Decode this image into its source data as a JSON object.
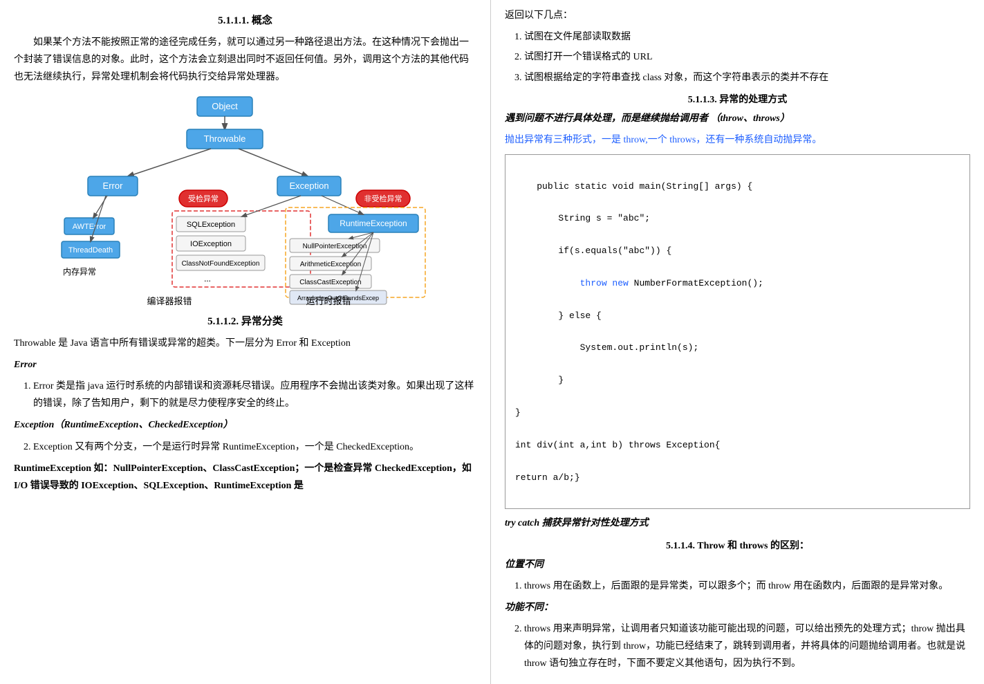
{
  "left": {
    "section_title": "5.1.1.1.   概念",
    "para1": "如果某个方法不能按照正常的途径完成任务，就可以通过另一种路径退出方法。在这种情况下会抛出一个封装了错误信息的对象。此时，这个方法会立刻退出同时不返回任何值。另外，调用这个方法的其他代码也无法继续执行，异常处理机制会将代码执行交给异常处理器。",
    "diagram_labels": {
      "object": "Object",
      "throwable": "Throwable",
      "error": "Error",
      "exception": "Exception",
      "awterror": "AWTError",
      "threaddeath": "ThreadDeath",
      "sqlexception": "SQLException",
      "ioexception": "IOException",
      "classnotfound": "ClassNotFoundException",
      "ellipsis": "...",
      "runtimeexception": "RuntimeException",
      "nullpointer": "NullPointerException",
      "arithmetic": "ArithmeticException",
      "classcast": "ClassCastException",
      "arrayindex": "ArrayIndexOutOfBundsExcep",
      "checked_label": "受检异常",
      "unchecked_label": "非受检异常",
      "compiler_error": "编译器报错",
      "runtime_error": "运行时报错",
      "memory_error": "内存异常"
    },
    "section512_title": "5.1.1.2.   异常分类",
    "para_throwable": "Throwable 是 Java 语言中所有错误或异常的超类。下一层分为 Error 和 Exception",
    "error_label": "Error",
    "error_item1": "Error 类是指 java 运行时系统的内部错误和资源耗尽错误。应用程序不会抛出该类对象。如果出现了这样的错误，除了告知用户，剩下的就是尽力使程序安全的终止。",
    "exception_label": "Exception（RuntimeException、CheckedException）",
    "exception_item2": "Exception 又有两个分支，一个是运行时异常 RuntimeException，一个是 CheckedException。",
    "runtime_label": "RuntimeException 如：NullPointerException、ClassCastException；一个是检查异常 CheckedException，如 I/O 错误导致的 IOException、SQLException、RuntimeException 是",
    "error_red": "Error",
    "exception_blue": "Exception"
  },
  "right": {
    "list_intro": "返回以下几点：",
    "list_items": [
      "试图在文件尾部读取数据",
      "试图打开一个错误格式的 URL",
      "试图根据给定的字符串查找 class 对象，而这个字符串表示的类并不存在"
    ],
    "section513_title": "5.1.1.3.    异常的处理方式",
    "bold_italic_text": "遇到问题不进行具体处理，而是继续抛给调用者 （throw、throws）",
    "blue_line": "抛出异常有三种形式，一是 throw,一个 throws，还有一种系统自动抛异常。",
    "code": "public static void main(String[] args) {\n\n    String s = \"abc\";\n\n    if(s.equals(\"abc\")) {\n\n      throw new NumberFormatException();\n\n    } else {\n\n      System.out.println(s);\n\n    }\n\n}\n\nint div(int a,int b) throws Exception{\n\nreturn a/b;}",
    "throw_highlight": "throw new",
    "try_catch_label": "try catch 捕获异常针对性处理方式",
    "section514_title": "5.1.1.4.    Throw 和 throws 的区别：",
    "pos_diff_label": "位置不同",
    "pos_diff_item1": "throws 用在函数上，后面跟的是异常类，可以跟多个；而 throw 用在函数内，后面跟的是异常对象。",
    "func_diff_label": "功能不同：",
    "func_diff_item2": "throws 用来声明异常，让调用者只知道该功能可能出现的问题，可以给出预先的处理方式；throw 抛出具体的问题对象，执行到 throw，功能已经结束了，跳转到调用者，并将具体的问题抛给调用者。也就是说 throw 语句独立存在时，下面不要定义其他语句，因为执行不到。"
  }
}
